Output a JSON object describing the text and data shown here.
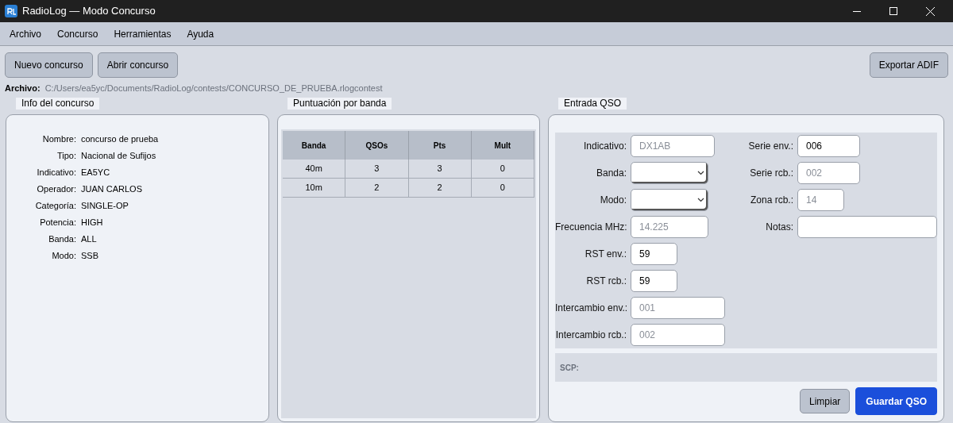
{
  "window": {
    "title": "RadioLog — Modo Concurso"
  },
  "menu": [
    "Archivo",
    "Concurso",
    "Herramientas",
    "Ayuda"
  ],
  "toolbar": {
    "left_buttons": [
      "Nuevo concurso",
      "Abrir concurso"
    ],
    "right_buttons": [
      "Exportar ADIF"
    ]
  },
  "file": {
    "label": "Archivo:",
    "path": "C:/Users/ea5yc/Documents/RadioLog/contests/CONCURSO_DE_PRUEBA.rlogcontest"
  },
  "info": {
    "title": "Info del concurso",
    "rows": [
      {
        "label": "Nombre:",
        "value": "concurso de prueba"
      },
      {
        "label": "Tipo:",
        "value": "Nacional de Sufijos"
      },
      {
        "label": "Indicativo:",
        "value": "EA5YC"
      },
      {
        "label": "Operador:",
        "value": "JUAN CARLOS"
      },
      {
        "label": "Categoría:",
        "value": "SINGLE-OP"
      },
      {
        "label": "Potencia:",
        "value": "HIGH"
      },
      {
        "label": "Banda:",
        "value": "ALL"
      },
      {
        "label": "Modo:",
        "value": "SSB"
      }
    ]
  },
  "score": {
    "title": "Puntuación por banda",
    "columns": [
      "Banda",
      "QSOs",
      "Pts",
      "Mult"
    ],
    "rows": [
      [
        "40m",
        "3",
        "3",
        "0"
      ],
      [
        "10m",
        "2",
        "2",
        "0"
      ]
    ]
  },
  "qso": {
    "title": "Entrada QSO",
    "left_fields": [
      {
        "label": "Indicativo:",
        "kind": "text",
        "placeholder": "DX1AB"
      },
      {
        "label": "Banda:",
        "kind": "select"
      },
      {
        "label": "Modo:",
        "kind": "select"
      },
      {
        "label": "Frecuencia MHz:",
        "kind": "text",
        "placeholder": "14.225"
      },
      {
        "label": "RST env.:",
        "kind": "text",
        "value": "59"
      },
      {
        "label": "RST rcb.:",
        "kind": "text",
        "value": "59"
      },
      {
        "label": "Intercambio env.:",
        "kind": "text",
        "placeholder": "001"
      },
      {
        "label": "Intercambio rcb.:",
        "kind": "text",
        "placeholder": "002"
      }
    ],
    "right_fields": [
      {
        "label": "Serie env.:",
        "kind": "text",
        "value": "006"
      },
      {
        "label": "Serie rcb.:",
        "kind": "text",
        "placeholder": "002"
      },
      {
        "label": "Zona rcb.:",
        "kind": "text",
        "placeholder": "14"
      },
      {
        "label": "Notas:",
        "kind": "text"
      }
    ],
    "scp": {
      "label": "SCP:"
    },
    "buttons": [
      {
        "label": "Limpiar",
        "kind": "secondary"
      },
      {
        "label": "Guardar QSO",
        "kind": "primary"
      }
    ]
  }
}
